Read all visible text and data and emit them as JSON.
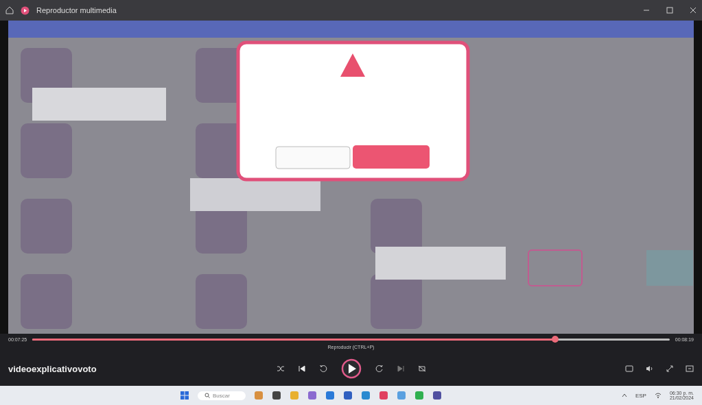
{
  "window": {
    "title": "Reproductor multimedia"
  },
  "player": {
    "elapsed": "00:07:25",
    "total": "00:08:19",
    "progress": {
      "level": 0.82
    },
    "tooltip": "Reproducir (CTRL+P)",
    "media_title": "videoexplicativovoto"
  },
  "taskbar": {
    "search_placeholder": "Buscar",
    "language": "ESP",
    "clock": "06:30 p. m.",
    "date": "21/02/2024"
  }
}
